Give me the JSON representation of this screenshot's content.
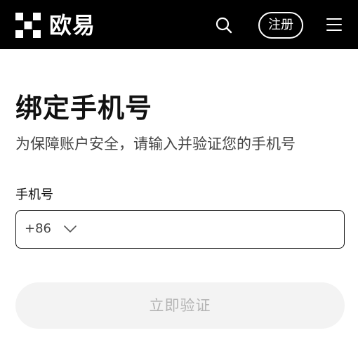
{
  "header": {
    "brand_name": "欧易",
    "logo_icon": "okx-logo-icon",
    "search_icon": "search-icon",
    "register_label": "注册",
    "menu_icon": "hamburger-menu-icon",
    "background_color": "#000000",
    "text_color": "#ffffff"
  },
  "main": {
    "title": "绑定手机号",
    "subtitle": "为保障账户安全，请输入并验证您的手机号",
    "phone": {
      "label": "手机号",
      "country_code": "+86",
      "chevron_icon": "chevron-down-icon",
      "value": "",
      "placeholder": ""
    },
    "verify_label": "立即验证",
    "verify_button_bg": "#f3f3f3",
    "verify_button_text_color": "#b3b3b3"
  }
}
